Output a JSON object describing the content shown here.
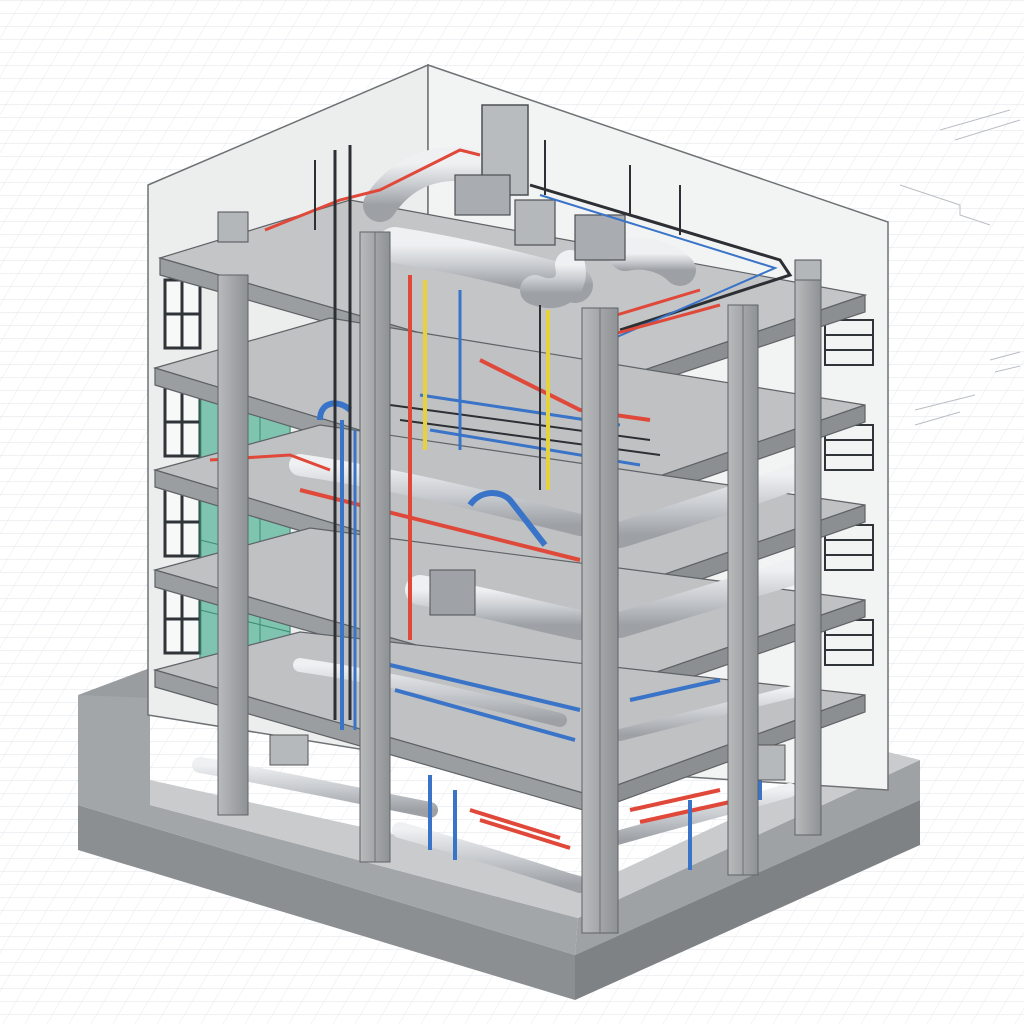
{
  "image": {
    "kind": "isometric cutaway building MEP model",
    "background_grid": true,
    "floors_visible": 5,
    "basement_visible": true
  },
  "colors": {
    "background": "#ffffff",
    "grid": "#d9dde3",
    "concrete": "#a9acae",
    "concrete_light": "#c4c6c8",
    "concrete_dark": "#8d9092",
    "wall": "#e9eaeb",
    "duct": "#d3d6d9",
    "duct_shade": "#a7abaf",
    "pipe_red": "#e0483a",
    "pipe_blue": "#3a74c8",
    "pipe_yellow": "#e6d23c",
    "pipe_black": "#2c2f33",
    "glass": "#5bb79a",
    "window": "#2f3438"
  },
  "legend": []
}
